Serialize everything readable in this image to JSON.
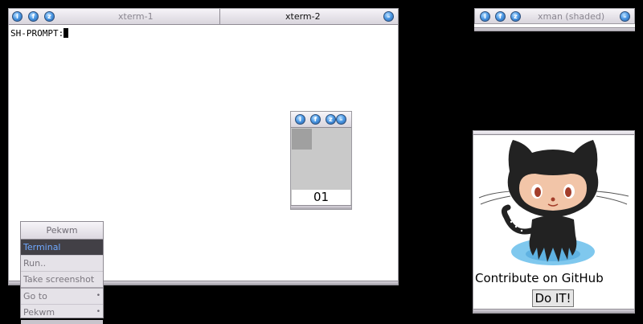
{
  "xterm": {
    "tabs": [
      "xterm-1",
      "xterm-2"
    ],
    "prompt": "SH-PROMPT:"
  },
  "xman": {
    "title": "xman (shaded)"
  },
  "small_window": {
    "value": "01"
  },
  "github": {
    "caption": "Contribute on GitHub",
    "button": "Do IT!"
  },
  "menu": {
    "title": "Pekwm",
    "items": [
      "Terminal",
      "Run..",
      "Take screenshot",
      "Go to",
      "Pekwm"
    ],
    "submenu_arrow": "•"
  },
  "colors": {
    "button_blue": "#4f9be6",
    "menu_highlight_text": "#6fa8ff"
  },
  "icons": [
    "iconify-icon",
    "maximize-icon",
    "close-icon",
    "shade-icon",
    "octocat-image"
  ]
}
